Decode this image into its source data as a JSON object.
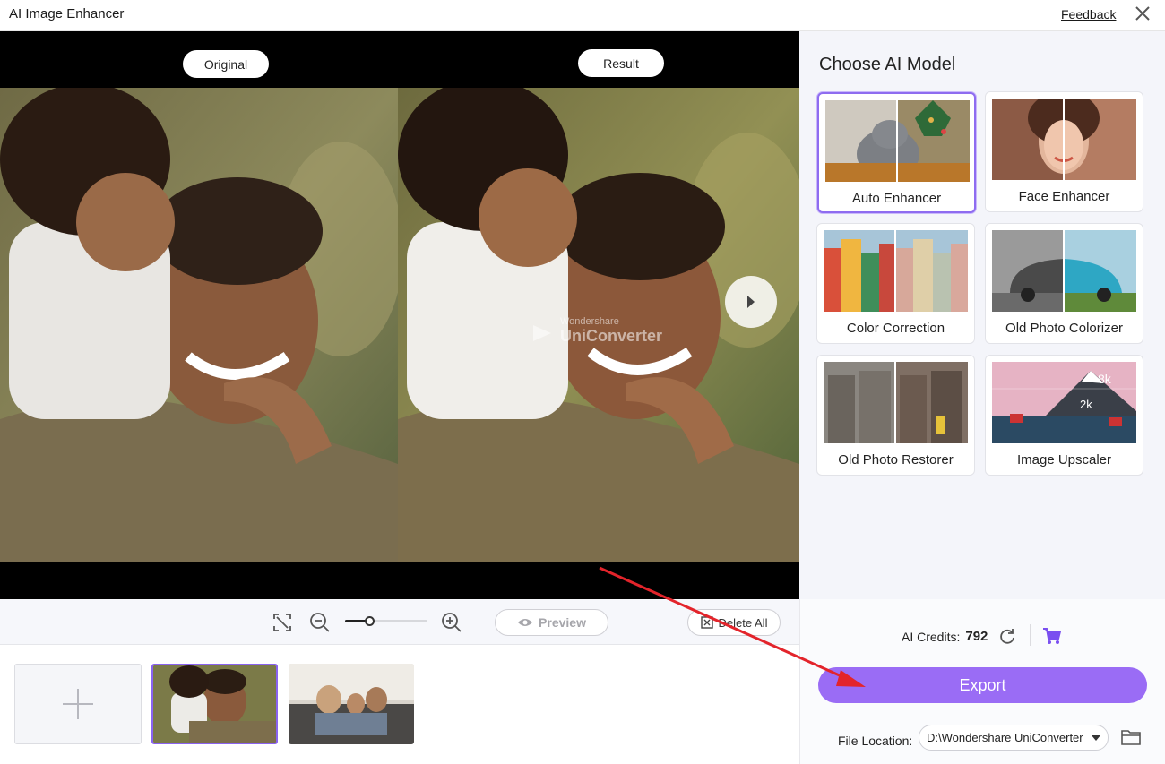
{
  "window": {
    "title": "AI Image Enhancer",
    "feedback_label": "Feedback"
  },
  "preview": {
    "original_label": "Original",
    "result_label": "Result",
    "watermark_small": "Wondershare",
    "watermark_big": "UniConverter"
  },
  "toolbar": {
    "preview_label": "Preview",
    "delete_all_label": "Delete All",
    "zoom_level": 0.3
  },
  "models": {
    "title": "Choose AI Model",
    "items": [
      {
        "label": "Auto Enhancer",
        "active": true
      },
      {
        "label": "Face Enhancer",
        "active": false
      },
      {
        "label": "Color Correction",
        "active": false
      },
      {
        "label": "Old Photo Colorizer",
        "active": false
      },
      {
        "label": "Old Photo Restorer",
        "active": false
      },
      {
        "label": "Image Upscaler",
        "active": false
      }
    ],
    "upscaler_badges": [
      "8k",
      "2k"
    ]
  },
  "footer": {
    "credits_label": "AI Credits:",
    "credits_value": "792",
    "export_label": "Export",
    "file_location_label": "File Location:",
    "file_location_value": "D:\\Wondershare UniConverter"
  },
  "colors": {
    "accent": "#9a6cf5",
    "annotation_arrow": "#e3242b"
  },
  "icons": [
    "close-icon",
    "fit-screen-icon",
    "zoom-out-icon",
    "zoom-in-icon",
    "eye-icon",
    "delete-icon",
    "next-arrow-icon",
    "add-icon",
    "refresh-icon",
    "cart-icon",
    "chevron-down-icon",
    "folder-icon"
  ]
}
